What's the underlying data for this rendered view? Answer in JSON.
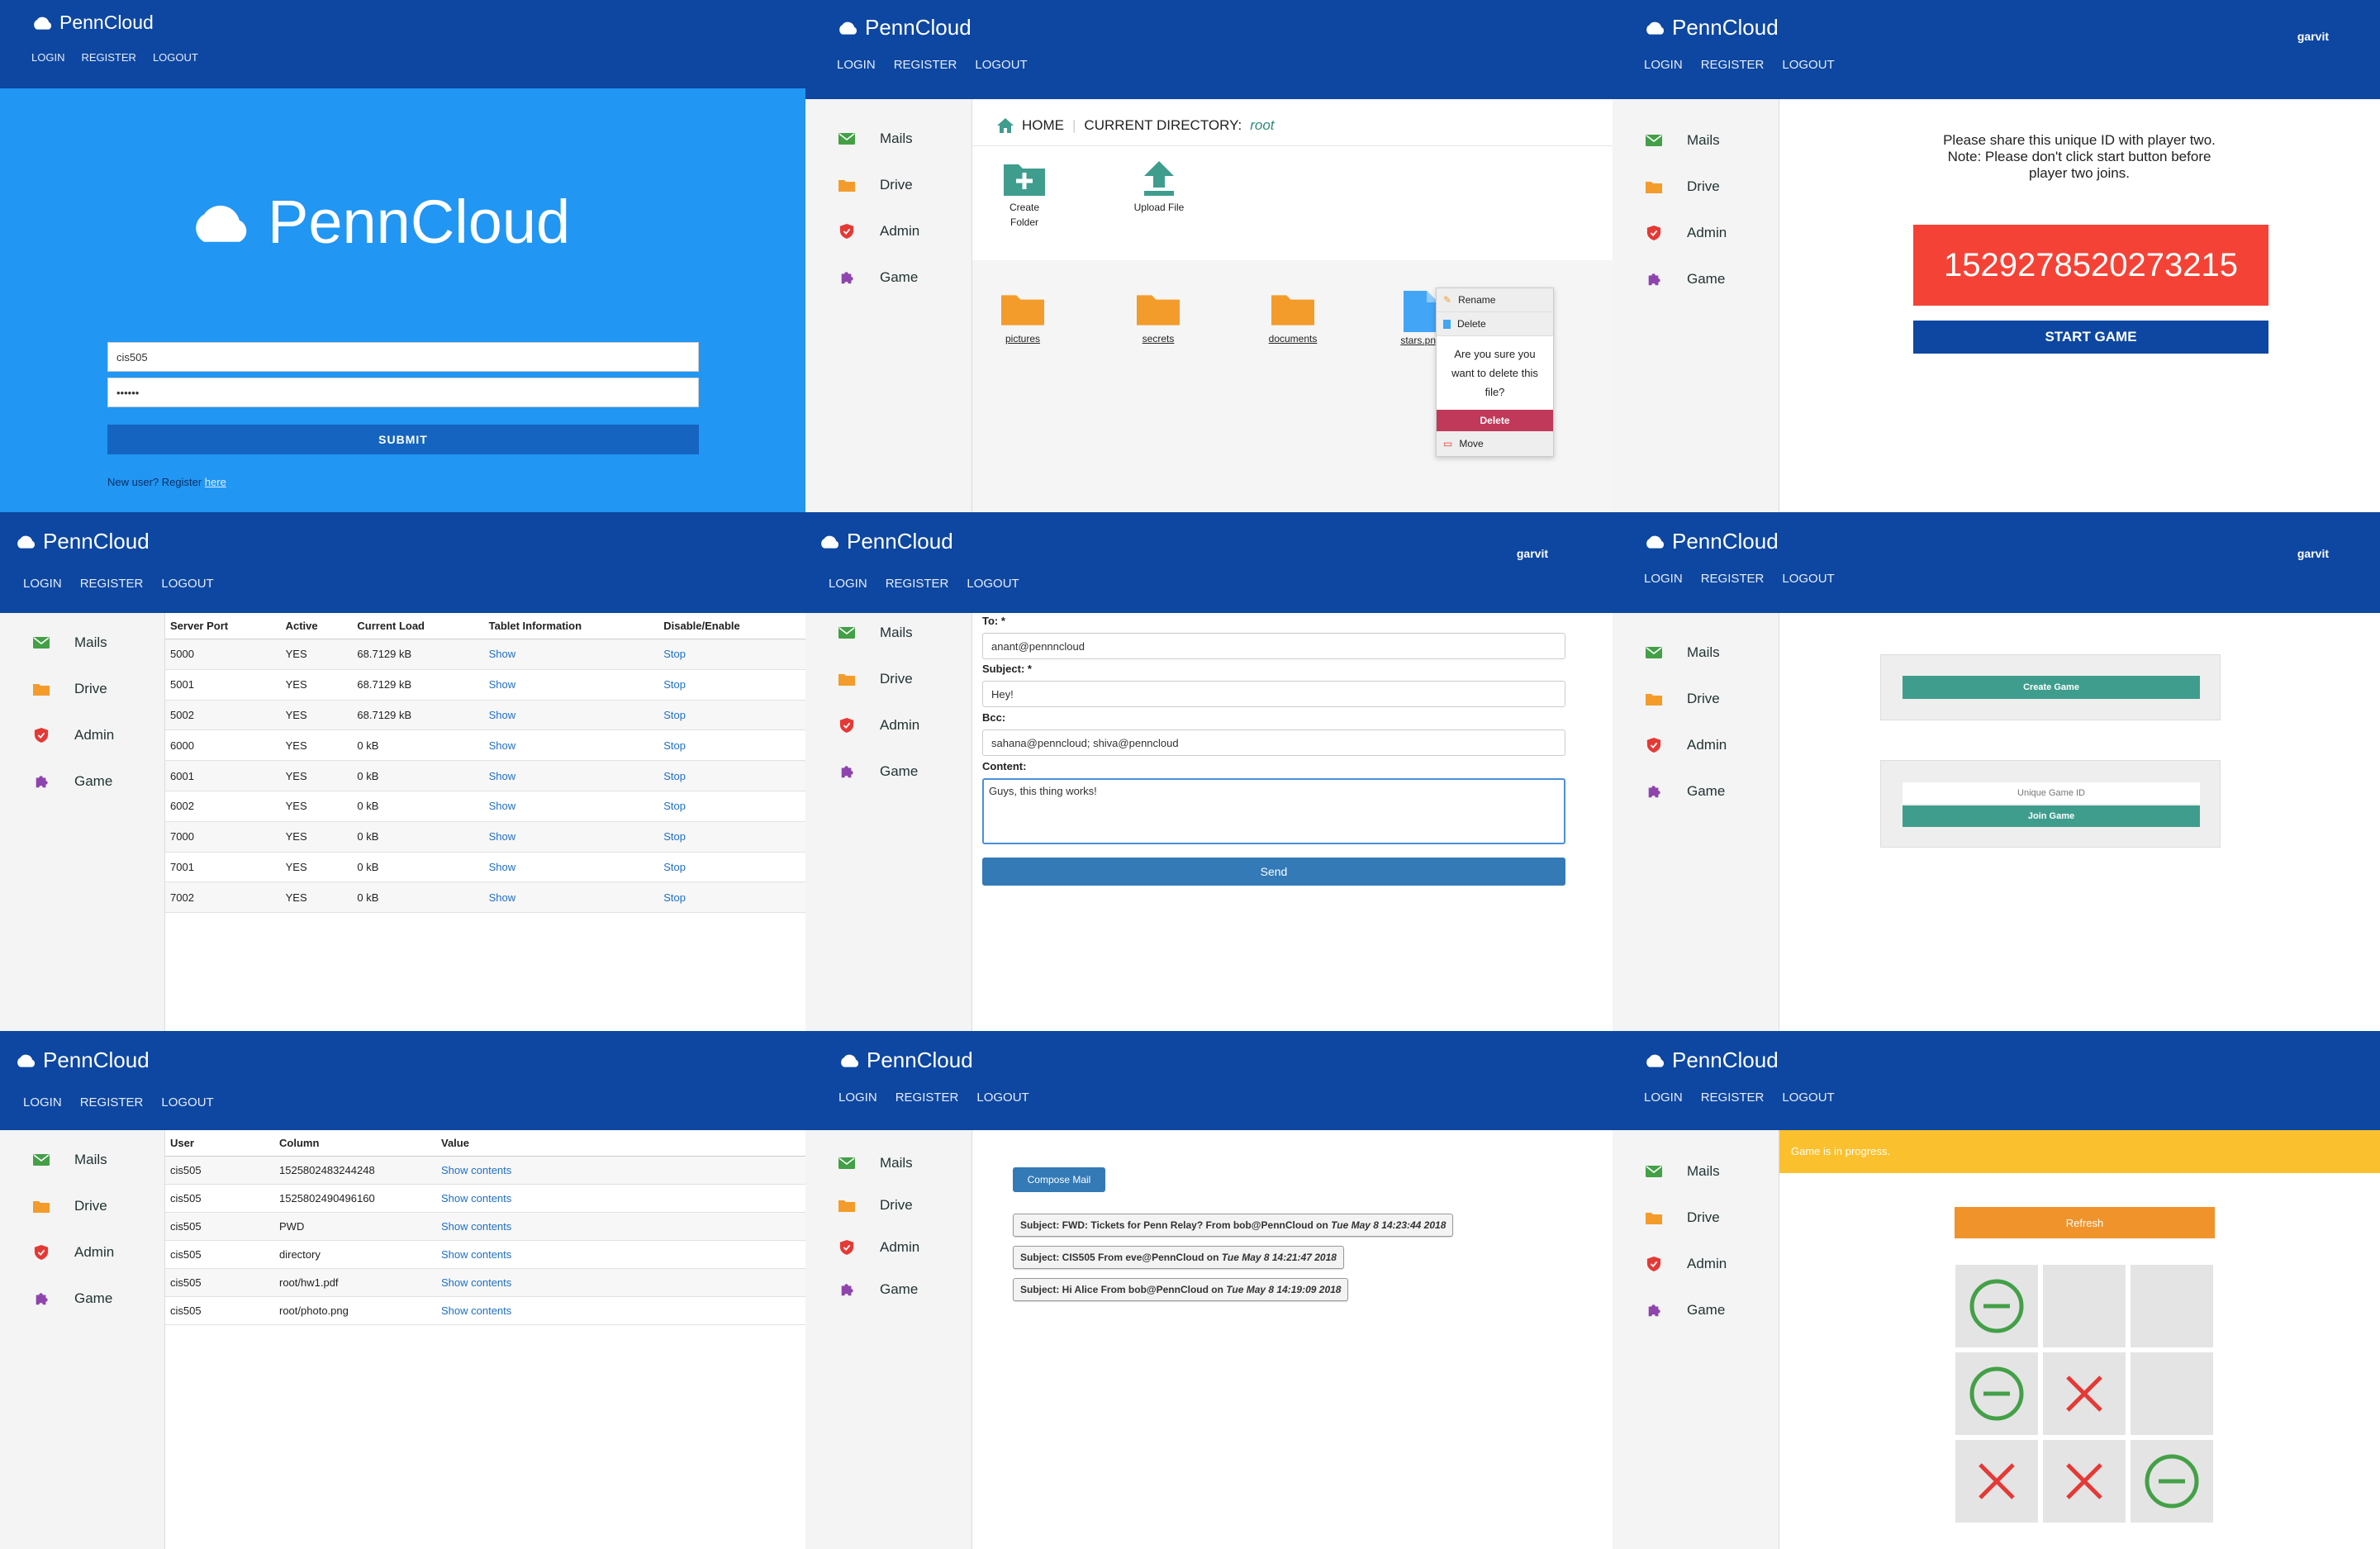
{
  "app": {
    "brand": "PennCloud"
  },
  "nav": {
    "login": "LOGIN",
    "register": "REGISTER",
    "logout": "LOGOUT"
  },
  "sidebar": {
    "items": [
      "Mails",
      "Drive",
      "Admin",
      "Game"
    ]
  },
  "user": {
    "name": "garvit"
  },
  "colors": {
    "header": "#0d47a1",
    "login_bg": "#2196f3",
    "mail_green": "#43a047",
    "folder_orange": "#f39c2b",
    "admin_red": "#e53935",
    "game_purple": "#8e44ad",
    "teal": "#3f9d8e",
    "danger": "#f44336",
    "warning_bar": "#fbc02d"
  },
  "login": {
    "logo_text": "PennCloud",
    "username_value": "cis505",
    "password_value": "••••••",
    "submit_label": "SUBMIT",
    "new_user_text": "New user? Register ",
    "here_link": "here"
  },
  "drive": {
    "home_label": "HOME",
    "current_dir_label": "CURRENT DIRECTORY:",
    "current_dir_value": "root",
    "create_folder_label": "Create Folder",
    "upload_file_label": "Upload File",
    "folders": [
      "pictures",
      "secrets",
      "documents"
    ],
    "file": "stars.png",
    "context_menu": {
      "rename": "Rename",
      "delete": "Delete",
      "confirm_text": "Are you sure you want to delete this file?",
      "confirm_delete": "Delete",
      "move": "Move"
    }
  },
  "game_share": {
    "message": "Please share this unique ID with player two. Note: Please don't click start button before player two joins.",
    "game_id": "1529278520273215",
    "start_label": "START GAME"
  },
  "servers": {
    "headers": [
      "Server Port",
      "Active",
      "Current Load",
      "Tablet Information",
      "Disable/Enable"
    ],
    "rows": [
      [
        "5000",
        "YES",
        "68.7129 kB",
        "Show",
        "Stop"
      ],
      [
        "5001",
        "YES",
        "68.7129 kB",
        "Show",
        "Stop"
      ],
      [
        "5002",
        "YES",
        "68.7129 kB",
        "Show",
        "Stop"
      ],
      [
        "6000",
        "YES",
        "0 kB",
        "Show",
        "Stop"
      ],
      [
        "6001",
        "YES",
        "0 kB",
        "Show",
        "Stop"
      ],
      [
        "6002",
        "YES",
        "0 kB",
        "Show",
        "Stop"
      ],
      [
        "7000",
        "YES",
        "0 kB",
        "Show",
        "Stop"
      ],
      [
        "7001",
        "YES",
        "0 kB",
        "Show",
        "Stop"
      ],
      [
        "7002",
        "YES",
        "0 kB",
        "Show",
        "Stop"
      ]
    ]
  },
  "compose": {
    "to_label": "To: *",
    "to_value": "anant@pennncloud",
    "subject_label": "Subject: *",
    "subject_value": "Hey!",
    "bcc_label": "Bcc:",
    "bcc_value": "sahana@penncloud; shiva@penncloud",
    "content_label": "Content:",
    "content_value": "Guys, this thing works!",
    "send_label": "Send"
  },
  "game_lobby": {
    "create_label": "Create Game",
    "unique_id_placeholder": "Unique Game ID",
    "join_label": "Join Game"
  },
  "storage": {
    "headers": [
      "User",
      "Column",
      "Value"
    ],
    "rows": [
      [
        "cis505",
        "1525802483244248",
        "Show contents"
      ],
      [
        "cis505",
        "1525802490496160",
        "Show contents"
      ],
      [
        "cis505",
        "PWD",
        "Show contents"
      ],
      [
        "cis505",
        "directory",
        "Show contents"
      ],
      [
        "cis505",
        "root/hw1.pdf",
        "Show contents"
      ],
      [
        "cis505",
        "root/photo.png",
        "Show contents"
      ]
    ]
  },
  "inbox": {
    "compose_label": "Compose Mail",
    "mails": [
      {
        "subject_prefix": "Subject: FWD: Tickets for Penn Relay? From bob@PennCloud on ",
        "date": "Tue May 8 14:23:44 2018"
      },
      {
        "subject_prefix": "Subject: CIS505 From eve@PennCloud on ",
        "date": "Tue May 8 14:21:47 2018"
      },
      {
        "subject_prefix": "Subject: Hi Alice From bob@PennCloud on ",
        "date": "Tue May 8 14:19:09 2018"
      }
    ]
  },
  "tictactoe": {
    "status": "Game is in progress.",
    "refresh_label": "Refresh",
    "board": [
      "O",
      "",
      "",
      "O",
      "X",
      "",
      "X",
      "X",
      "O"
    ]
  }
}
